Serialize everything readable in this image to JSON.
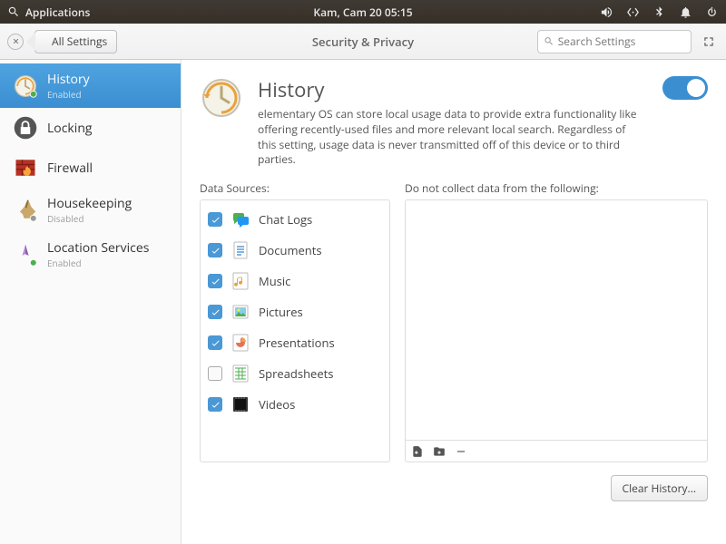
{
  "panel": {
    "applications_label": "Applications",
    "clock": "Kam, Cam 20   05:15"
  },
  "window": {
    "back_label": "All Settings",
    "title": "Security & Privacy",
    "search_placeholder": "Search Settings"
  },
  "sidebar": {
    "items": [
      {
        "label": "History",
        "sub": "Enabled",
        "icon": "history-icon",
        "active": true,
        "status_dot": "#4caf50"
      },
      {
        "label": "Locking",
        "sub": "",
        "icon": "lock-icon",
        "active": false,
        "status_dot": ""
      },
      {
        "label": "Firewall",
        "sub": "",
        "icon": "firewall-icon",
        "active": false,
        "status_dot": ""
      },
      {
        "label": "Housekeeping",
        "sub": "Disabled",
        "icon": "housekeeping-icon",
        "active": false,
        "status_dot": "#999"
      },
      {
        "label": "Location Services",
        "sub": "Enabled",
        "icon": "location-icon",
        "active": false,
        "status_dot": "#4caf50"
      }
    ]
  },
  "page": {
    "title": "History",
    "description": "elementary OS can store local usage data to provide extra functionality like offering recently-used files and more relevant local search. Regardless of this setting, usage data is never transmitted off of this device or to third parties.",
    "toggle_on": true,
    "sources_label": "Data Sources:",
    "exclude_label": "Do not collect data from the following:",
    "sources": [
      {
        "label": "Chat Logs",
        "checked": true,
        "icon": "chat-icon"
      },
      {
        "label": "Documents",
        "checked": true,
        "icon": "document-icon"
      },
      {
        "label": "Music",
        "checked": true,
        "icon": "music-icon"
      },
      {
        "label": "Pictures",
        "checked": true,
        "icon": "picture-icon"
      },
      {
        "label": "Presentations",
        "checked": true,
        "icon": "presentation-icon"
      },
      {
        "label": "Spreadsheets",
        "checked": false,
        "icon": "spreadsheet-icon"
      },
      {
        "label": "Videos",
        "checked": true,
        "icon": "video-icon"
      }
    ],
    "clear_button": "Clear History..."
  },
  "colors": {
    "accent": "#3b8fd1"
  }
}
